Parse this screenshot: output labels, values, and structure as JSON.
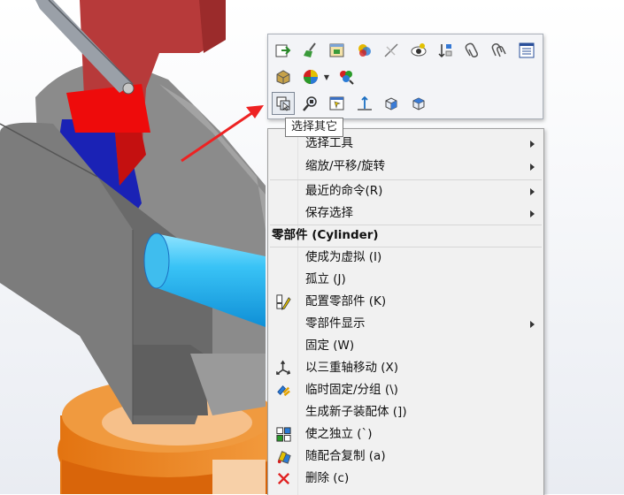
{
  "tooltip": {
    "text": "选择其它"
  },
  "toolbar": {
    "rows": [
      [
        "export-icon",
        "broom-icon",
        "window-icon",
        "appearance-icon",
        "hide-icon",
        "show-icon",
        "sort-icon",
        "paperclip-icon",
        "double-paperclip-icon",
        "list-icon"
      ],
      [
        "material-icon",
        "color-palette-icon",
        "multi-color-icon"
      ],
      [
        "select-other-icon",
        "zoom-to-selection-icon",
        "window-select-icon",
        "normal-to-icon",
        "view-orientation-icon",
        "display-style-icon"
      ]
    ]
  },
  "menu": {
    "items": [
      {
        "id": "select-tools",
        "label": "选择工具",
        "submenu": true
      },
      {
        "id": "zoom-pan-rotate",
        "label": "缩放/平移/旋转",
        "submenu": true
      },
      {
        "id": "recent-commands",
        "label": "最近的命令(R)",
        "submenu": true
      },
      {
        "id": "save-selection",
        "label": "保存选择",
        "submenu": true
      }
    ],
    "section_header": "零部件 (Cylinder)",
    "section_items": [
      {
        "id": "make-virtual",
        "label": "使成为虚拟 (I)",
        "icon": ""
      },
      {
        "id": "isolate",
        "label": "孤立 (J)",
        "icon": ""
      },
      {
        "id": "configure-component",
        "label": "配置零部件 (K)",
        "icon": "configure-component-icon"
      },
      {
        "id": "component-display",
        "label": "零部件显示",
        "icon": "",
        "submenu": true
      },
      {
        "id": "fix",
        "label": "固定 (W)",
        "icon": ""
      },
      {
        "id": "move-triad",
        "label": "以三重轴移动 (X)",
        "icon": "triad-icon"
      },
      {
        "id": "temp-fix-group",
        "label": "临时固定/分组 (\\)",
        "icon": "temp-fix-icon"
      },
      {
        "id": "new-subassembly",
        "label": "生成新子装配体 (])",
        "icon": ""
      },
      {
        "id": "make-independent",
        "label": "使之独立 (`)",
        "icon": "make-independent-icon"
      },
      {
        "id": "copy-with-mates",
        "label": "随配合复制 (a)",
        "icon": "copy-with-mates-icon"
      },
      {
        "id": "delete",
        "label": "删除 (c)",
        "icon": "delete-icon"
      }
    ]
  }
}
